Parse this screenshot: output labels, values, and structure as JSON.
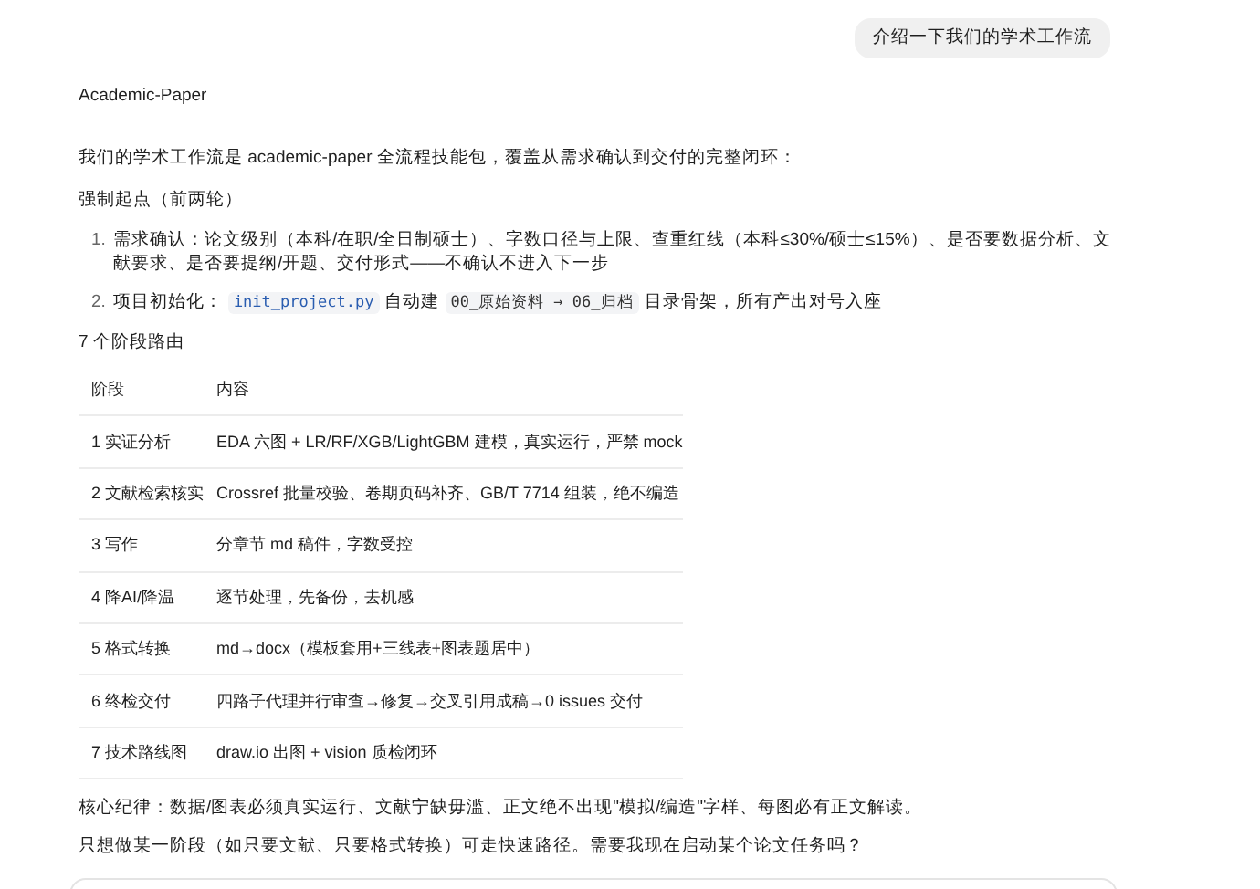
{
  "user_message": {
    "text": "介绍一下我们的学术工作流"
  },
  "reply": {
    "title": "Academic-Paper",
    "intro": "我们的学术工作流是 academic-paper 全流程技能包，覆盖从需求确认到交付的完整闭环：",
    "section_1": "强制起点（前两轮）",
    "steps": [
      {
        "number": "1.",
        "parts": [
          {
            "kind": "text",
            "text": "需求确认：论文级别（本科/在职/全日制硕士）、字数口径与上限、查重红线（本科≤30%/硕士≤15%）、是否要数据分析、文献要求、是否要提纲/开题、交付形式——不确认不进入下一步"
          }
        ]
      },
      {
        "number": "2.",
        "parts": [
          {
            "kind": "text",
            "text": "项目初始化："
          },
          {
            "kind": "code",
            "text": "init_project.py"
          },
          {
            "kind": "text",
            "text": "自动建"
          },
          {
            "kind": "code",
            "text": "00_原始资料 → 06_归档"
          },
          {
            "kind": "text",
            "text": "目录骨架，所有产出对号入座"
          }
        ]
      }
    ],
    "section_2": "7 个阶段路由",
    "table": {
      "columns": [
        "阶段",
        "内容"
      ],
      "rows": [
        [
          "1 实证分析",
          "EDA 六图 + LR/RF/XGB/LightGBM 建模，真实运行，严禁 mock"
        ],
        [
          "2 文献检索核实",
          "Crossref 批量校验、卷期页码补齐、GB/T 7714 组装，绝不编造"
        ],
        [
          "3 写作",
          "分章节 md 稿件，字数受控"
        ],
        [
          "4 降AI/降温",
          "逐节处理，先备份，去机感"
        ],
        [
          "5 格式转换",
          "md→docx（模板套用+三线表+图表题居中）"
        ],
        [
          "6 终检交付",
          "四路子代理并行审查→修复→交叉引用成稿→0 issues 交付"
        ],
        [
          "7 技术路线图",
          "draw.io 出图 + vision 质检闭环"
        ]
      ]
    },
    "rule": "核心纪律：数据/图表必须真实运行、文献宁缺毋滥、正文绝不出现\"模拟/编造\"字样、每图必有正文解读。",
    "closing": "只想做某一阶段（如只要文献、只要格式转换）可走快速路径。需要我现在启动某个论文任务吗？"
  }
}
